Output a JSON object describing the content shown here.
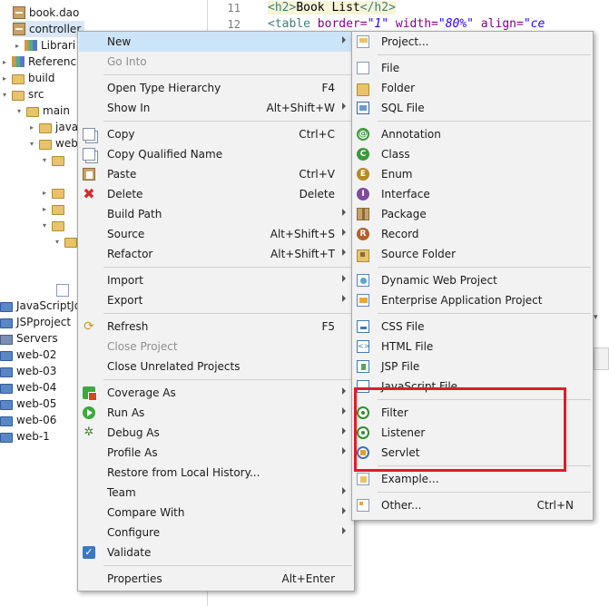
{
  "explorer": {
    "rows": [
      {
        "label": "book.dao"
      },
      {
        "label": "controller"
      },
      {
        "label": "Librari"
      },
      {
        "label": "Referenc"
      },
      {
        "label": "build"
      },
      {
        "label": "src"
      },
      {
        "label": "main"
      },
      {
        "label": "java"
      },
      {
        "label": "web"
      },
      {
        "label": "JavaScriptJq"
      },
      {
        "label": "JSPproject"
      },
      {
        "label": "Servers"
      },
      {
        "label": "web-02"
      },
      {
        "label": "web-03"
      },
      {
        "label": "web-04"
      },
      {
        "label": "web-05"
      },
      {
        "label": "web-06"
      },
      {
        "label": "web-1"
      }
    ]
  },
  "editor": {
    "line1_number": "11",
    "line2_number": "12",
    "line1": {
      "open": "<h2>",
      "text": "Book List",
      "close": "</h2>"
    },
    "line2": {
      "tag": "<table ",
      "attr1": "border=",
      "val1": "\"1\"",
      "attr2": " width=",
      "val2": "\"80%\"",
      "attr3": " align=",
      "val3": "\"ce"
    }
  },
  "context_menu": {
    "items": [
      {
        "label": "New",
        "shortcut": "",
        "submenu": true,
        "highlighted": true
      },
      {
        "label": "Go Into",
        "shortcut": "",
        "disabled": true
      },
      {
        "label": "Open Type Hierarchy",
        "shortcut": "F4"
      },
      {
        "label": "Show In",
        "shortcut": "Alt+Shift+W",
        "submenu": true
      },
      {
        "label": "Copy",
        "shortcut": "Ctrl+C",
        "icon": "copy-icon"
      },
      {
        "label": "Copy Qualified Name",
        "shortcut": "",
        "icon": "copy-icon"
      },
      {
        "label": "Paste",
        "shortcut": "Ctrl+V",
        "icon": "paste-icon"
      },
      {
        "label": "Delete",
        "shortcut": "Delete",
        "icon": "delete-icon"
      },
      {
        "label": "Build Path",
        "shortcut": "",
        "submenu": true
      },
      {
        "label": "Source",
        "shortcut": "Alt+Shift+S",
        "submenu": true
      },
      {
        "label": "Refactor",
        "shortcut": "Alt+Shift+T",
        "submenu": true
      },
      {
        "label": "Import",
        "shortcut": "",
        "submenu": true
      },
      {
        "label": "Export",
        "shortcut": "",
        "submenu": true
      },
      {
        "label": "Refresh",
        "shortcut": "F5",
        "icon": "refresh-icon"
      },
      {
        "label": "Close Project",
        "shortcut": "",
        "disabled": true
      },
      {
        "label": "Close Unrelated Projects",
        "shortcut": ""
      },
      {
        "label": "Coverage As",
        "shortcut": "",
        "submenu": true,
        "icon": "coverage-icon"
      },
      {
        "label": "Run As",
        "shortcut": "",
        "submenu": true,
        "icon": "run-icon"
      },
      {
        "label": "Debug As",
        "shortcut": "",
        "submenu": true,
        "icon": "bug-icon"
      },
      {
        "label": "Profile As",
        "shortcut": "",
        "submenu": true
      },
      {
        "label": "Restore from Local History...",
        "shortcut": ""
      },
      {
        "label": "Team",
        "shortcut": "",
        "submenu": true
      },
      {
        "label": "Compare With",
        "shortcut": "",
        "submenu": true
      },
      {
        "label": "Configure",
        "shortcut": "",
        "submenu": true
      },
      {
        "label": "Validate",
        "shortcut": "",
        "icon": "checkbox-icon"
      },
      {
        "label": "Properties",
        "shortcut": "Alt+Enter"
      }
    ]
  },
  "new_submenu": {
    "items": [
      {
        "label": "Project..."
      },
      {
        "label": "File"
      },
      {
        "label": "Folder"
      },
      {
        "label": "SQL File"
      },
      {
        "label": "Annotation"
      },
      {
        "label": "Class"
      },
      {
        "label": "Enum"
      },
      {
        "label": "Interface"
      },
      {
        "label": "Package"
      },
      {
        "label": "Record"
      },
      {
        "label": "Source Folder"
      },
      {
        "label": "Dynamic Web Project"
      },
      {
        "label": "Enterprise Application Project"
      },
      {
        "label": "CSS File"
      },
      {
        "label": "HTML File"
      },
      {
        "label": "JSP File"
      },
      {
        "label": "JavaScript File"
      },
      {
        "label": "Filter"
      },
      {
        "label": "Listener"
      },
      {
        "label": "Servlet"
      },
      {
        "label": "Example..."
      },
      {
        "label": "Other...",
        "shortcut": "Ctrl+N"
      }
    ]
  },
  "annotation": {
    "color": "#e21b2a",
    "target": "Filter, Listener, Servlet"
  }
}
